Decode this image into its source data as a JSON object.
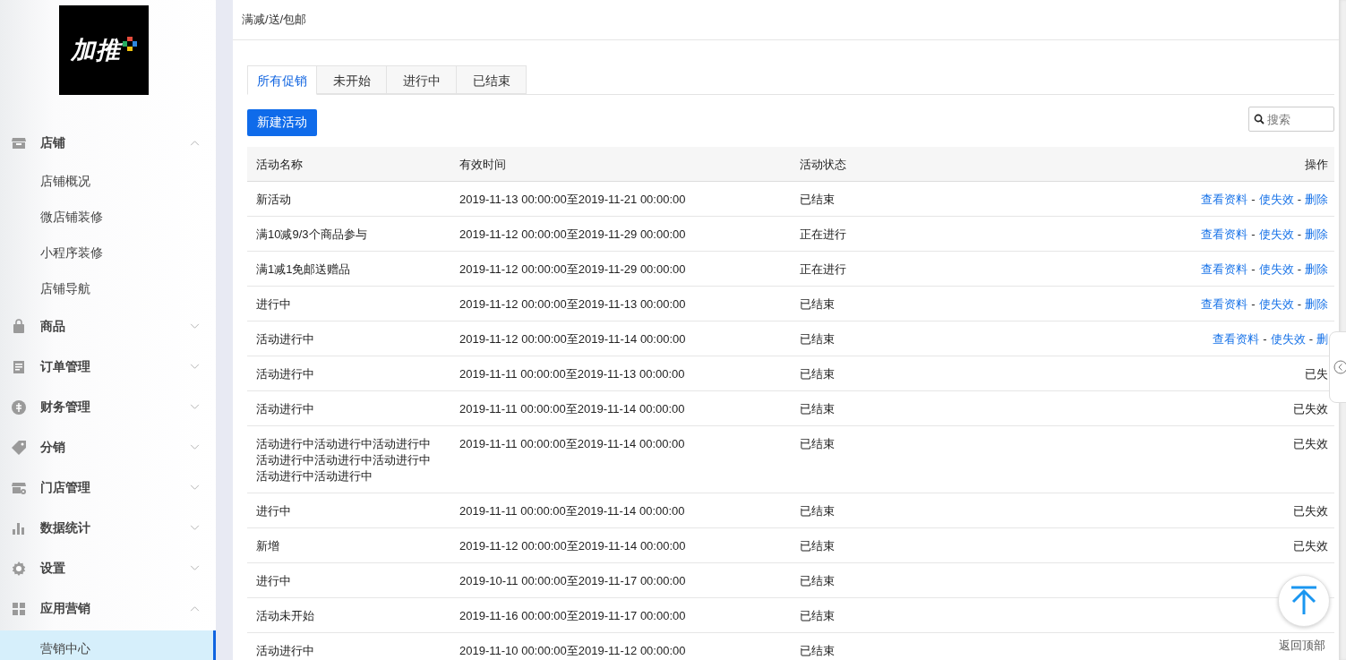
{
  "logo": {
    "text": "加推"
  },
  "sidebar": {
    "items": [
      {
        "label": "店铺",
        "expanded": true,
        "children": [
          {
            "label": "店铺概况",
            "selected": false
          },
          {
            "label": "微店铺装修",
            "selected": false
          },
          {
            "label": "小程序装修",
            "selected": false
          },
          {
            "label": "店铺导航",
            "selected": false
          }
        ]
      },
      {
        "label": "商品",
        "expanded": false
      },
      {
        "label": "订单管理",
        "expanded": false
      },
      {
        "label": "财务管理",
        "expanded": false
      },
      {
        "label": "分销",
        "expanded": false
      },
      {
        "label": "门店管理",
        "expanded": false
      },
      {
        "label": "数据统计",
        "expanded": false
      },
      {
        "label": "设置",
        "expanded": false
      },
      {
        "label": "应用营销",
        "expanded": true,
        "children": [
          {
            "label": "营销中心",
            "selected": true
          }
        ]
      }
    ]
  },
  "breadcrumb": "满减/送/包邮",
  "tabs": [
    {
      "label": "所有促销",
      "selected": true
    },
    {
      "label": "未开始",
      "selected": false
    },
    {
      "label": "进行中",
      "selected": false
    },
    {
      "label": "已结束",
      "selected": false
    }
  ],
  "new_button": "新建活动",
  "search": {
    "placeholder": "搜索"
  },
  "table": {
    "columns": [
      "活动名称",
      "有效时间",
      "活动状态",
      "操作"
    ],
    "rows": [
      {
        "name": "新活动",
        "time": "2019-11-13 00:00:00至2019-11-21 00:00:00",
        "status": "已结束",
        "action": {
          "kind": "links",
          "items": [
            "查看资料",
            "使失效",
            "删除"
          ],
          "separator": "-"
        }
      },
      {
        "name": "满10减9/3个商品参与",
        "time": "2019-11-12 00:00:00至2019-11-29 00:00:00",
        "status": "正在进行",
        "action": {
          "kind": "links",
          "items": [
            "查看资料",
            "使失效",
            "删除"
          ],
          "separator": "-"
        }
      },
      {
        "name": "满1减1免邮送赠品",
        "time": "2019-11-12 00:00:00至2019-11-29 00:00:00",
        "status": "正在进行",
        "action": {
          "kind": "links",
          "items": [
            "查看资料",
            "使失效",
            "删除"
          ],
          "separator": "-"
        }
      },
      {
        "name": "进行中",
        "time": "2019-11-12 00:00:00至2019-11-13 00:00:00",
        "status": "已结束",
        "action": {
          "kind": "links",
          "items": [
            "查看资料",
            "使失效",
            "删除"
          ],
          "separator": "-"
        }
      },
      {
        "name": "活动进行中",
        "time": "2019-11-12 00:00:00至2019-11-14 00:00:00",
        "status": "已结束",
        "action": {
          "kind": "links",
          "items": [
            "查看资料",
            "使失效",
            "删"
          ],
          "separator": "-"
        }
      },
      {
        "name": "活动进行中",
        "time": "2019-11-11 00:00:00至2019-11-13 00:00:00",
        "status": "已结束",
        "action": {
          "kind": "text",
          "text": "已失"
        }
      },
      {
        "name": "活动进行中",
        "time": "2019-11-11 00:00:00至2019-11-14 00:00:00",
        "status": "已结束",
        "action": {
          "kind": "text",
          "text": "已失效"
        }
      },
      {
        "name": "活动进行中活动进行中活动进行中活动进行中活动进行中活动进行中活动进行中活动进行中",
        "time": "2019-11-11 00:00:00至2019-11-14 00:00:00",
        "status": "已结束",
        "action": {
          "kind": "text",
          "text": "已失效"
        }
      },
      {
        "name": "进行中",
        "time": "2019-11-11 00:00:00至2019-11-14 00:00:00",
        "status": "已结束",
        "action": {
          "kind": "text",
          "text": "已失效"
        }
      },
      {
        "name": "新增",
        "time": "2019-11-12 00:00:00至2019-11-14 00:00:00",
        "status": "已结束",
        "action": {
          "kind": "text",
          "text": "已失效"
        }
      },
      {
        "name": "进行中",
        "time": "2019-10-11 00:00:00至2019-11-17 00:00:00",
        "status": "已结束"
      },
      {
        "name": "活动未开始",
        "time": "2019-11-16 00:00:00至2019-11-17 00:00:00",
        "status": "已结束"
      },
      {
        "name": "活动进行中",
        "time": "2019-11-10 00:00:00至2019-11-12 00:00:00",
        "status": "已结束"
      }
    ]
  },
  "back_to_top": {
    "label": "返回顶部"
  }
}
